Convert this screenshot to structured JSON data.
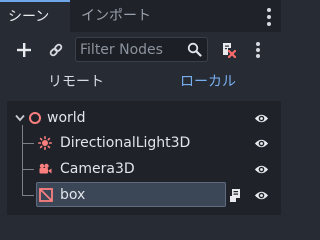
{
  "tabs": [
    {
      "label": "シーン",
      "active": true
    },
    {
      "label": "インポート",
      "active": false
    }
  ],
  "toolbar": {
    "add_icon": "plus-icon",
    "link_icon": "link-icon",
    "filter_placeholder": "Filter Nodes",
    "search_icon": "search-icon",
    "script_filter_icon": "script-filter-icon",
    "menu_icon": "kebab-icon"
  },
  "scene_mode": {
    "remote_label": "リモート",
    "local_label": "ローカル",
    "active": "local"
  },
  "tree": {
    "root": {
      "label": "world",
      "icon": "node3d-icon",
      "visible": true
    },
    "children": [
      {
        "label": "DirectionalLight3D",
        "icon": "directional-light-icon",
        "visible": true
      },
      {
        "label": "Camera3D",
        "icon": "camera-icon",
        "visible": true
      },
      {
        "label": "box",
        "icon": "csg-box-icon",
        "visible": true,
        "selected": true,
        "has_script": true
      }
    ]
  },
  "colors": {
    "accent": "#78aef0",
    "node3d": "#fc7f7f",
    "tab_bg": "#1f2329",
    "panel_bg": "#272c34"
  }
}
